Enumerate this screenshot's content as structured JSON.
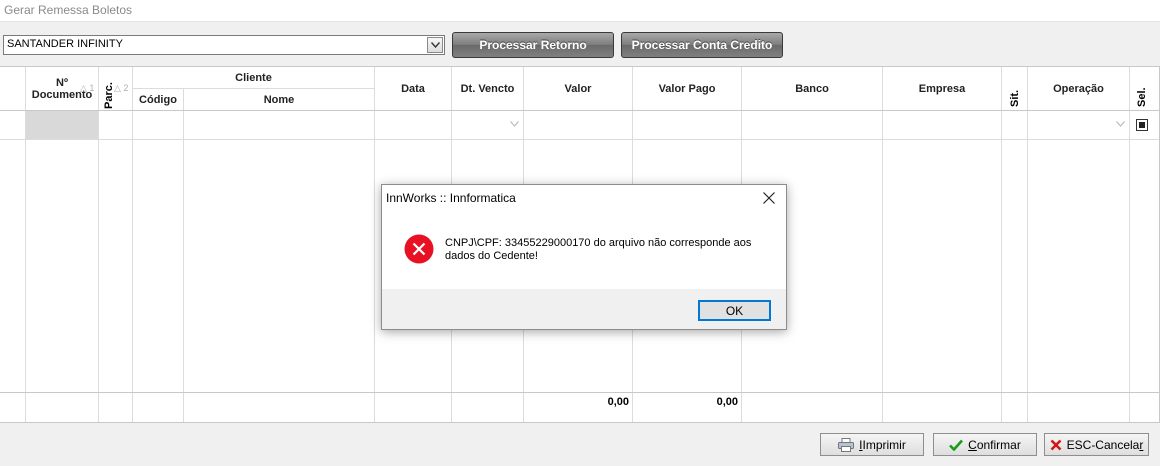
{
  "window": {
    "title": "Gerar Remessa Boletos"
  },
  "toolbar": {
    "bank_select_value": "SANTANDER INFINITY",
    "process_return_label": "Processar Retorno",
    "process_credit_label": "Processar Conta Credito"
  },
  "grid": {
    "headers": {
      "doc_line1": "Nº",
      "doc_line2": "Documento",
      "doc_sort": "△ 1",
      "parc": "Parc.",
      "parc_sort": "△ 2",
      "cliente": "Cliente",
      "codigo": "Código",
      "nome": "Nome",
      "data": "Data",
      "dt_vencto": "Dt. Vencto",
      "valor": "Valor",
      "valor_pago": "Valor Pago",
      "banco": "Banco",
      "empresa": "Empresa",
      "sit": "Sit.",
      "operacao": "Operação",
      "sel": "Sel."
    },
    "totals": {
      "valor": "0,00",
      "valor_pago": "0,00"
    }
  },
  "footer": {
    "print_label": "Imprimir",
    "print_key": "I",
    "confirm_label": "onfirmar",
    "confirm_key": "C",
    "cancel_label_pre": "ESC-Cancela",
    "cancel_key": "r"
  },
  "dialog": {
    "title": "InnWorks :: Innformatica",
    "message": "CNPJ\\CPF: 33455229000170 do arquivo não corresponde aos dados do Cedente!",
    "ok_label": "OK"
  },
  "colors": {
    "error": "#e81123",
    "accent": "#0078d7",
    "confirm_check": "#1a9c1a",
    "cancel_x": "#d01818"
  }
}
